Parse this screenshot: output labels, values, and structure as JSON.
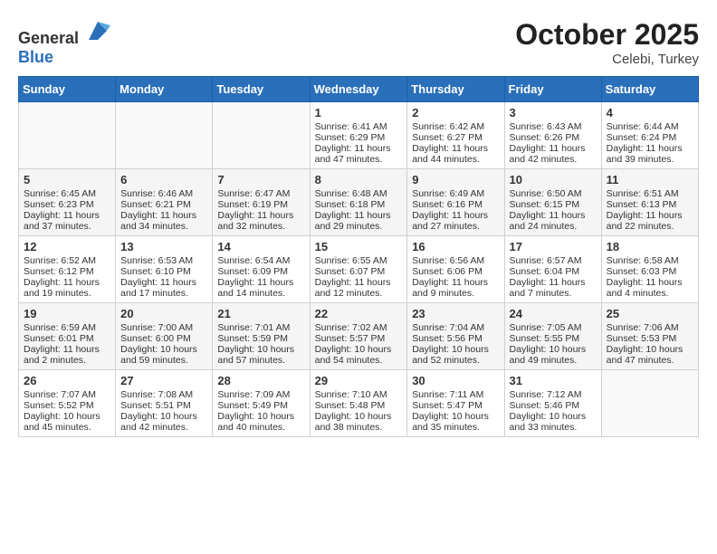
{
  "header": {
    "logo_general": "General",
    "logo_blue": "Blue",
    "month": "October 2025",
    "location": "Celebi, Turkey"
  },
  "weekdays": [
    "Sunday",
    "Monday",
    "Tuesday",
    "Wednesday",
    "Thursday",
    "Friday",
    "Saturday"
  ],
  "weeks": [
    [
      {
        "day": "",
        "data": ""
      },
      {
        "day": "",
        "data": ""
      },
      {
        "day": "",
        "data": ""
      },
      {
        "day": "1",
        "data": "Sunrise: 6:41 AM\nSunset: 6:29 PM\nDaylight: 11 hours and 47 minutes."
      },
      {
        "day": "2",
        "data": "Sunrise: 6:42 AM\nSunset: 6:27 PM\nDaylight: 11 hours and 44 minutes."
      },
      {
        "day": "3",
        "data": "Sunrise: 6:43 AM\nSunset: 6:26 PM\nDaylight: 11 hours and 42 minutes."
      },
      {
        "day": "4",
        "data": "Sunrise: 6:44 AM\nSunset: 6:24 PM\nDaylight: 11 hours and 39 minutes."
      }
    ],
    [
      {
        "day": "5",
        "data": "Sunrise: 6:45 AM\nSunset: 6:23 PM\nDaylight: 11 hours and 37 minutes."
      },
      {
        "day": "6",
        "data": "Sunrise: 6:46 AM\nSunset: 6:21 PM\nDaylight: 11 hours and 34 minutes."
      },
      {
        "day": "7",
        "data": "Sunrise: 6:47 AM\nSunset: 6:19 PM\nDaylight: 11 hours and 32 minutes."
      },
      {
        "day": "8",
        "data": "Sunrise: 6:48 AM\nSunset: 6:18 PM\nDaylight: 11 hours and 29 minutes."
      },
      {
        "day": "9",
        "data": "Sunrise: 6:49 AM\nSunset: 6:16 PM\nDaylight: 11 hours and 27 minutes."
      },
      {
        "day": "10",
        "data": "Sunrise: 6:50 AM\nSunset: 6:15 PM\nDaylight: 11 hours and 24 minutes."
      },
      {
        "day": "11",
        "data": "Sunrise: 6:51 AM\nSunset: 6:13 PM\nDaylight: 11 hours and 22 minutes."
      }
    ],
    [
      {
        "day": "12",
        "data": "Sunrise: 6:52 AM\nSunset: 6:12 PM\nDaylight: 11 hours and 19 minutes."
      },
      {
        "day": "13",
        "data": "Sunrise: 6:53 AM\nSunset: 6:10 PM\nDaylight: 11 hours and 17 minutes."
      },
      {
        "day": "14",
        "data": "Sunrise: 6:54 AM\nSunset: 6:09 PM\nDaylight: 11 hours and 14 minutes."
      },
      {
        "day": "15",
        "data": "Sunrise: 6:55 AM\nSunset: 6:07 PM\nDaylight: 11 hours and 12 minutes."
      },
      {
        "day": "16",
        "data": "Sunrise: 6:56 AM\nSunset: 6:06 PM\nDaylight: 11 hours and 9 minutes."
      },
      {
        "day": "17",
        "data": "Sunrise: 6:57 AM\nSunset: 6:04 PM\nDaylight: 11 hours and 7 minutes."
      },
      {
        "day": "18",
        "data": "Sunrise: 6:58 AM\nSunset: 6:03 PM\nDaylight: 11 hours and 4 minutes."
      }
    ],
    [
      {
        "day": "19",
        "data": "Sunrise: 6:59 AM\nSunset: 6:01 PM\nDaylight: 11 hours and 2 minutes."
      },
      {
        "day": "20",
        "data": "Sunrise: 7:00 AM\nSunset: 6:00 PM\nDaylight: 10 hours and 59 minutes."
      },
      {
        "day": "21",
        "data": "Sunrise: 7:01 AM\nSunset: 5:59 PM\nDaylight: 10 hours and 57 minutes."
      },
      {
        "day": "22",
        "data": "Sunrise: 7:02 AM\nSunset: 5:57 PM\nDaylight: 10 hours and 54 minutes."
      },
      {
        "day": "23",
        "data": "Sunrise: 7:04 AM\nSunset: 5:56 PM\nDaylight: 10 hours and 52 minutes."
      },
      {
        "day": "24",
        "data": "Sunrise: 7:05 AM\nSunset: 5:55 PM\nDaylight: 10 hours and 49 minutes."
      },
      {
        "day": "25",
        "data": "Sunrise: 7:06 AM\nSunset: 5:53 PM\nDaylight: 10 hours and 47 minutes."
      }
    ],
    [
      {
        "day": "26",
        "data": "Sunrise: 7:07 AM\nSunset: 5:52 PM\nDaylight: 10 hours and 45 minutes."
      },
      {
        "day": "27",
        "data": "Sunrise: 7:08 AM\nSunset: 5:51 PM\nDaylight: 10 hours and 42 minutes."
      },
      {
        "day": "28",
        "data": "Sunrise: 7:09 AM\nSunset: 5:49 PM\nDaylight: 10 hours and 40 minutes."
      },
      {
        "day": "29",
        "data": "Sunrise: 7:10 AM\nSunset: 5:48 PM\nDaylight: 10 hours and 38 minutes."
      },
      {
        "day": "30",
        "data": "Sunrise: 7:11 AM\nSunset: 5:47 PM\nDaylight: 10 hours and 35 minutes."
      },
      {
        "day": "31",
        "data": "Sunrise: 7:12 AM\nSunset: 5:46 PM\nDaylight: 10 hours and 33 minutes."
      },
      {
        "day": "",
        "data": ""
      }
    ]
  ]
}
